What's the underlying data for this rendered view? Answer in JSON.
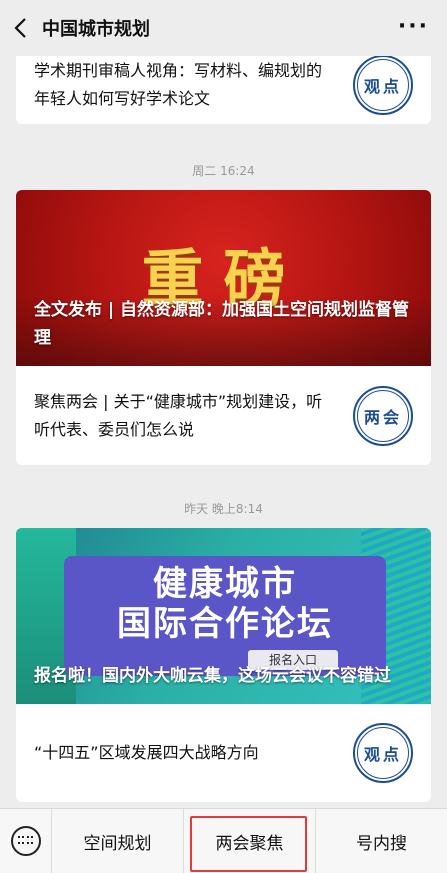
{
  "header": {
    "title": "中国城市规划",
    "more": "···"
  },
  "feed": {
    "card1": {
      "text": "学术期刊审稿人视角：写材料、编规划的年轻人如何写好学术论文",
      "badge": "观点"
    },
    "time1": "周二 16:24",
    "card2": {
      "cover_big_text": "重磅",
      "cover_caption": "全文发布 | 自然资源部：加强国土空间规划监督管理",
      "text": "聚焦两会 | 关于“健康城市”规划建设，听听代表、委员们怎么说",
      "badge": "两会"
    },
    "time2": "昨天 晚上8:14",
    "card3": {
      "cover_title_line1": "健康城市",
      "cover_title_line2": "国际合作论坛",
      "cover_pill": "报名入口",
      "cover_caption": "报名啦！国内外大咖云集，这场云会议不容错过",
      "text": "“十四五”区域发展四大战略方向",
      "badge": "观点"
    }
  },
  "bottom_menu": {
    "items": [
      "空间规划",
      "两会聚焦",
      "号内搜"
    ],
    "active": "两会聚焦"
  },
  "colors": {
    "badge": "#1b4d96",
    "highlight": "#e53a3a"
  }
}
